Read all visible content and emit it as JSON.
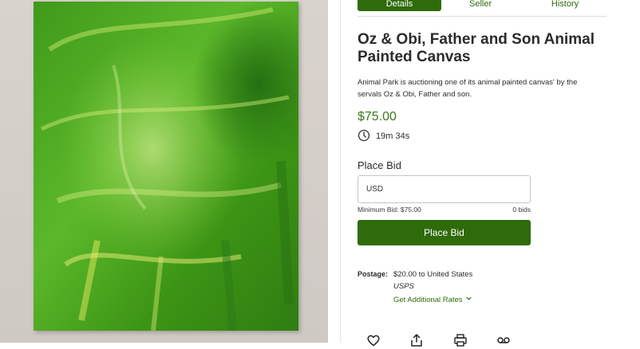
{
  "tabs": [
    {
      "label": "Details",
      "active": true
    },
    {
      "label": "Seller",
      "active": false
    },
    {
      "label": "History",
      "active": false
    }
  ],
  "item": {
    "title": "Oz & Obi, Father and Son Animal Painted Canvas",
    "description": "Animal Park is auctioning one of its animal painted canvas' by the servals Oz & Obi, Father and son.",
    "price": "$75.00",
    "time_left": "19m 34s",
    "image_icon": "green-abstract-painting"
  },
  "bid": {
    "heading": "Place Bid",
    "input_placeholder": "USD",
    "minimum": "Minimum Bid: $75.00",
    "bids_count": "0 bids",
    "button_label": "Place Bid"
  },
  "postage": {
    "label": "Postage:",
    "cost_line": "$20.00 to United States",
    "carrier": "USPS",
    "rates_link": "Get Additional Rates"
  },
  "actions": [
    {
      "icon": "heart-icon"
    },
    {
      "icon": "share-icon"
    },
    {
      "icon": "print-icon"
    },
    {
      "icon": "voicemail-icon"
    }
  ],
  "colors": {
    "accent": "#2f6b0a",
    "price": "#3c7a1d",
    "painting_base": "#4caf1e"
  }
}
